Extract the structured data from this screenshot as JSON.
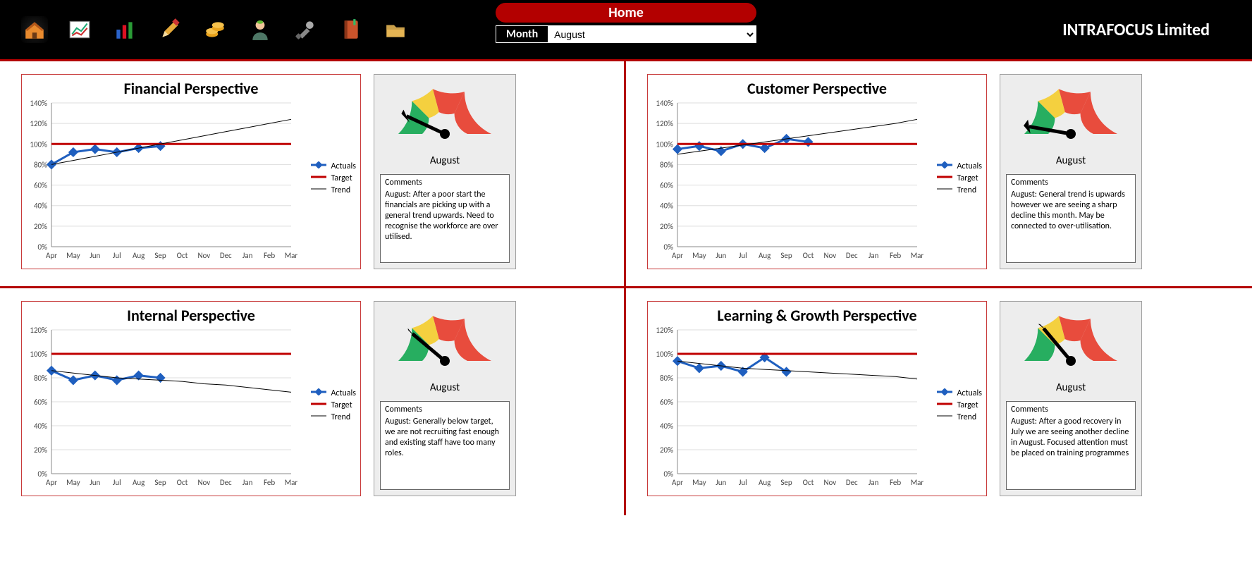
{
  "brand": "INTRAFOCUS Limited",
  "home_label": "Home",
  "month_label": "Month",
  "month_selected": "August",
  "icons": [
    "home-icon",
    "dashboard-icon",
    "bars-icon",
    "pencil-icon",
    "coins-icon",
    "person-icon",
    "tools-icon",
    "book-icon",
    "folder-icon"
  ],
  "legend": {
    "actuals": "Actuals",
    "target": "Target",
    "trend": "Trend"
  },
  "comments_header": "Comments",
  "panels": {
    "financial": {
      "title": "Financial Perspective",
      "gauge_label": "August",
      "gauge_angle": 155,
      "comment": "August: After a poor start the financials are picking up with a general trend upwards.  Need to recognise the workforce are over utilised.",
      "chart_key": "financial"
    },
    "customer": {
      "title": "Customer Perspective",
      "gauge_label": "August",
      "gauge_angle": 170,
      "comment": "August: General trend is upwards however we are seeing a sharp decline this month.  May be connected to over-utilisation.",
      "chart_key": "customer"
    },
    "internal": {
      "title": "Internal Perspective",
      "gauge_label": "August",
      "gauge_angle": 140,
      "comment": "August: Generally below target, we are not recruiting fast enough and existing staff have too many roles.",
      "chart_key": "internal"
    },
    "learning": {
      "title": "Learning & Growth Perspective",
      "gauge_label": "August",
      "gauge_angle": 130,
      "comment": "August: After a good recovery in July we are seeing another decline in August.  Focused attention must be placed on training programmes",
      "chart_key": "learning"
    }
  },
  "chart_data": [
    {
      "id": "financial",
      "type": "line",
      "title": "Financial Perspective",
      "categories": [
        "Apr",
        "May",
        "Jun",
        "Jul",
        "Aug",
        "Sep",
        "Oct",
        "Nov",
        "Dec",
        "Jan",
        "Feb",
        "Mar"
      ],
      "ylim": [
        0,
        140
      ],
      "yticks": [
        0,
        20,
        40,
        60,
        80,
        100,
        120,
        140
      ],
      "series": [
        {
          "name": "Actuals",
          "values": [
            80,
            92,
            95,
            92,
            96,
            98,
            null,
            null,
            null,
            null,
            null,
            null
          ],
          "color": "#1f5fbf",
          "markers": true,
          "width": 3
        },
        {
          "name": "Target",
          "values": [
            100,
            100,
            100,
            100,
            100,
            100,
            100,
            100,
            100,
            100,
            100,
            100
          ],
          "color": "#c00000",
          "width": 3
        },
        {
          "name": "Trend",
          "values": [
            80,
            84,
            88,
            92,
            96,
            100,
            104,
            108,
            112,
            116,
            120,
            124
          ],
          "color": "#000",
          "width": 1
        }
      ]
    },
    {
      "id": "customer",
      "type": "line",
      "title": "Customer Perspective",
      "categories": [
        "Apr",
        "May",
        "Jun",
        "Jul",
        "Aug",
        "Sep",
        "Oct",
        "Nov",
        "Dec",
        "Jan",
        "Feb",
        "Mar"
      ],
      "ylim": [
        0,
        140
      ],
      "yticks": [
        0,
        20,
        40,
        60,
        80,
        100,
        120,
        140
      ],
      "series": [
        {
          "name": "Actuals",
          "values": [
            95,
            98,
            93,
            100,
            96,
            105,
            102,
            null,
            null,
            null,
            null,
            null
          ],
          "color": "#1f5fbf",
          "markers": true,
          "width": 3
        },
        {
          "name": "Target",
          "values": [
            100,
            100,
            100,
            100,
            100,
            100,
            100,
            100,
            100,
            100,
            100,
            100
          ],
          "color": "#c00000",
          "width": 3
        },
        {
          "name": "Trend",
          "values": [
            90,
            93,
            96,
            99,
            102,
            105,
            108,
            111,
            114,
            117,
            120,
            124
          ],
          "color": "#000",
          "width": 1
        }
      ]
    },
    {
      "id": "internal",
      "type": "line",
      "title": "Internal Perspective",
      "categories": [
        "Apr",
        "May",
        "Jun",
        "Jul",
        "Aug",
        "Sep",
        "Oct",
        "Nov",
        "Dec",
        "Jan",
        "Feb",
        "Mar"
      ],
      "ylim": [
        0,
        120
      ],
      "yticks": [
        0,
        20,
        40,
        60,
        80,
        100,
        120
      ],
      "series": [
        {
          "name": "Actuals",
          "values": [
            86,
            78,
            82,
            78,
            82,
            80,
            null,
            null,
            null,
            null,
            null,
            null
          ],
          "color": "#1f5fbf",
          "markers": true,
          "width": 3
        },
        {
          "name": "Target",
          "values": [
            100,
            100,
            100,
            100,
            100,
            100,
            100,
            100,
            100,
            100,
            100,
            100
          ],
          "color": "#c00000",
          "width": 3
        },
        {
          "name": "Trend",
          "values": [
            86,
            84,
            82,
            80,
            79,
            78,
            77,
            75,
            74,
            72,
            70,
            68
          ],
          "color": "#000",
          "width": 1
        }
      ]
    },
    {
      "id": "learning",
      "type": "line",
      "title": "Learning & Growth Perspective",
      "categories": [
        "Apr",
        "May",
        "Jun",
        "Jul",
        "Aug",
        "Sep",
        "Oct",
        "Nov",
        "Dec",
        "Jan",
        "Feb",
        "Mar"
      ],
      "ylim": [
        0,
        120
      ],
      "yticks": [
        0,
        20,
        40,
        60,
        80,
        100,
        120
      ],
      "series": [
        {
          "name": "Actuals",
          "values": [
            94,
            88,
            90,
            85,
            97,
            85,
            null,
            null,
            null,
            null,
            null,
            null
          ],
          "color": "#1f5fbf",
          "markers": true,
          "width": 3
        },
        {
          "name": "Target",
          "values": [
            100,
            100,
            100,
            100,
            100,
            100,
            100,
            100,
            100,
            100,
            100,
            100
          ],
          "color": "#c00000",
          "width": 3
        },
        {
          "name": "Trend",
          "values": [
            94,
            92,
            90,
            88,
            87,
            86,
            85,
            84,
            83,
            82,
            81,
            79
          ],
          "color": "#000",
          "width": 1
        }
      ]
    }
  ]
}
